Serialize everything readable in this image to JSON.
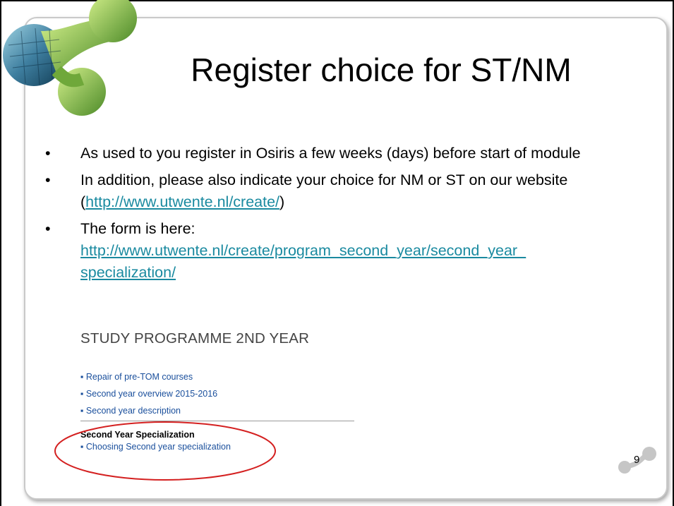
{
  "slide": {
    "title": "Register choice for ST/NM",
    "bullet_char": "•",
    "bullets": {
      "b1": {
        "text": "As used to you register in Osiris a few weeks (days) before start of module"
      },
      "b2": {
        "text_before": "In addition, please also indicate your choice for NM or ST on our website (",
        "link": "http://www.utwente.nl/create/",
        "text_after": ")"
      },
      "b3": {
        "text": "The form is here:",
        "link_line1": "http://www.utwente.nl/create/program_second_year/second_year_",
        "link_line2": "specialization/"
      }
    },
    "page_number": "9"
  },
  "excerpt": {
    "heading": "STUDY PROGRAMME 2ND YEAR",
    "nav_links": {
      "l1": "▪ Repair of pre-TOM courses",
      "l2": "▪ Second year overview 2015-2016",
      "l3": "▪ Second year description"
    },
    "specialization_heading": "Second Year Specialization",
    "specialization_link": "▪ Choosing Second year specialization"
  },
  "colors": {
    "link": "#1a8aa0",
    "excerpt_link": "#1a4f9c",
    "highlight": "#d42020",
    "frame": "#c9c9c9"
  }
}
